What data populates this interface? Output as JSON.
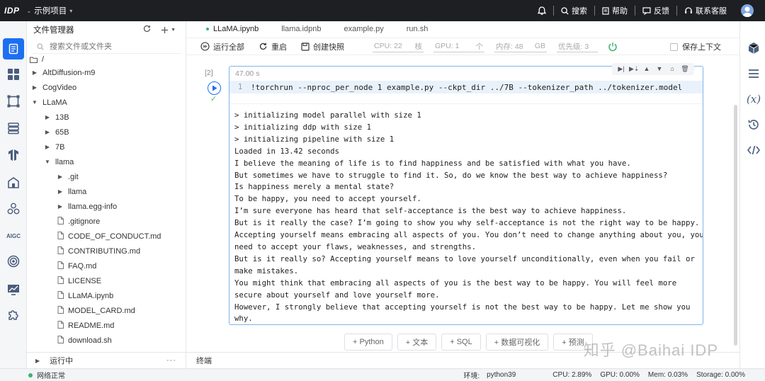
{
  "topbar": {
    "logo": "IDP",
    "project": "示例项目",
    "search": "搜索",
    "help": "帮助",
    "feedback": "反馈",
    "support": "联系客服"
  },
  "file_panel": {
    "title": "文件管理器",
    "search_placeholder": "搜索文件或文件夹",
    "root": "/",
    "items": [
      {
        "label": "AltDiffusion-m9",
        "type": "folder",
        "depth": 0,
        "expanded": false
      },
      {
        "label": "CogVideo",
        "type": "folder",
        "depth": 0,
        "expanded": false
      },
      {
        "label": "LLaMA",
        "type": "folder",
        "depth": 0,
        "expanded": true
      },
      {
        "label": "13B",
        "type": "folder",
        "depth": 1,
        "expanded": false
      },
      {
        "label": "65B",
        "type": "folder",
        "depth": 1,
        "expanded": false
      },
      {
        "label": "7B",
        "type": "folder",
        "depth": 1,
        "expanded": false
      },
      {
        "label": "llama",
        "type": "folder",
        "depth": 1,
        "expanded": true
      },
      {
        "label": ".git",
        "type": "folder",
        "depth": 2,
        "expanded": false
      },
      {
        "label": "llama",
        "type": "folder",
        "depth": 2,
        "expanded": false
      },
      {
        "label": "llama.egg-info",
        "type": "folder",
        "depth": 2,
        "expanded": false
      },
      {
        "label": ".gitignore",
        "type": "file",
        "depth": 2
      },
      {
        "label": "CODE_OF_CONDUCT.md",
        "type": "file",
        "depth": 2
      },
      {
        "label": "CONTRIBUTING.md",
        "type": "file",
        "depth": 2
      },
      {
        "label": "FAQ.md",
        "type": "file",
        "depth": 2
      },
      {
        "label": "LICENSE",
        "type": "file",
        "depth": 2
      },
      {
        "label": "LLaMA.ipynb",
        "type": "file",
        "depth": 2
      },
      {
        "label": "MODEL_CARD.md",
        "type": "file",
        "depth": 2
      },
      {
        "label": "README.md",
        "type": "file",
        "depth": 2
      },
      {
        "label": "download.sh",
        "type": "file",
        "depth": 2
      }
    ],
    "running": "运行中",
    "more": "···"
  },
  "tabs": [
    {
      "label": "LLaMA.ipynb",
      "active": true
    },
    {
      "label": "llama.idpnb",
      "active": false
    },
    {
      "label": "example.py",
      "active": false
    },
    {
      "label": "run.sh",
      "active": false
    }
  ],
  "toolbar": {
    "run_all": "运行全部",
    "restart": "重启",
    "snapshot": "创建快照",
    "cpu_label": "CPU: 22",
    "cpu_unit": "核",
    "gpu_label": "GPU: 1",
    "gpu_unit": "个",
    "mem_label": "内存: 48",
    "mem_unit": "GB",
    "priority_label": "优先级: 3",
    "save_context": "保存上下文"
  },
  "cell": {
    "exec_count": "[2]",
    "time": "47.00 s",
    "line_no": "1",
    "code": "!torchrun --nproc_per_node 1 example.py --ckpt_dir ../7B --tokenizer_path ../tokenizer.model",
    "output": "> initializing model parallel with size 1\n> initializing ddp with size 1\n> initializing pipeline with size 1\nLoaded in 13.42 seconds\nI believe the meaning of life is to find happiness and be satisfied with what you have.\nBut sometimes we have to struggle to find it. So, do we know the best way to achieve happiness?\nIs happiness merely a mental state?\nTo be happy, you need to accept yourself.\nI’m sure everyone has heard that self-acceptance is the best way to achieve happiness.\nBut is it really the case? I’m going to show you why self-acceptance is not the right way to be happy.\nAccepting yourself means embracing all aspects of you. You don’t need to change anything about you, you\nneed to accept your flaws, weaknesses, and strengths.\nBut is it really so? Accepting yourself means to love yourself unconditionally, even when you fail or\nmake mistakes.\nYou might think that embracing all aspects of you is the best way to be happy. You will feel more\nsecure about yourself and love yourself more.\nHowever, I strongly believe that accepting yourself is not the best way to be happy. Let me show you\nwhy."
  },
  "add_buttons": [
    "+ Python",
    "+ 文本",
    "+ SQL",
    "+ 数据可视化",
    "+ 预测"
  ],
  "terminal": "终端",
  "watermark": "知乎 @Baihai IDP",
  "statusbar": {
    "network": "网络正常",
    "env_label": "环境:",
    "env_value": "python39",
    "cpu": "CPU: 2.89%",
    "gpu": "GPU: 0.00%",
    "mem": "Mem: 0.03%",
    "storage": "Storage: 0.00%"
  },
  "colors": {
    "accent": "#1d6ff2",
    "topbar_bg": "#1e1f23",
    "running_green": "#3cb371"
  }
}
